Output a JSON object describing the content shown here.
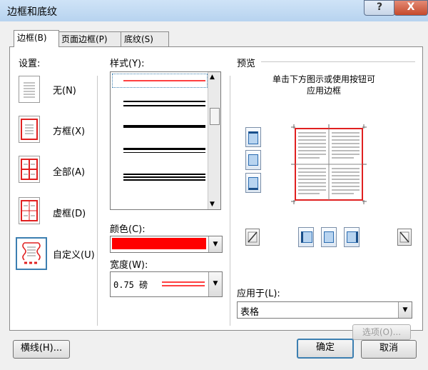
{
  "window": {
    "title": "边框和底纹",
    "help": "?",
    "close": "X"
  },
  "tabs": [
    {
      "label": "边框(B)"
    },
    {
      "label": "页面边框(P)"
    },
    {
      "label": "底纹(S)"
    }
  ],
  "settings": {
    "heading": "设置:",
    "items": [
      {
        "label": "无(N)"
      },
      {
        "label": "方框(X)"
      },
      {
        "label": "全部(A)"
      },
      {
        "label": "虚框(D)"
      },
      {
        "label": "自定义(U)"
      }
    ]
  },
  "style": {
    "heading": "样式(Y):"
  },
  "color": {
    "heading": "颜色(C):",
    "value": "#ff0000"
  },
  "width": {
    "heading": "宽度(W):",
    "value": "0.75 磅"
  },
  "preview": {
    "heading": "预览",
    "hint_line1": "单击下方图示或使用按钮可",
    "hint_line2": "应用边框"
  },
  "apply_to": {
    "heading": "应用于(L):",
    "value": "表格"
  },
  "buttons": {
    "options": "选项(O)...",
    "horizontal_line": "横线(H)...",
    "ok": "确定",
    "cancel": "取消"
  },
  "colors": {
    "accent_red": "#e02020",
    "titlebar": "#c3dbf3",
    "close": "#c54a2c"
  }
}
